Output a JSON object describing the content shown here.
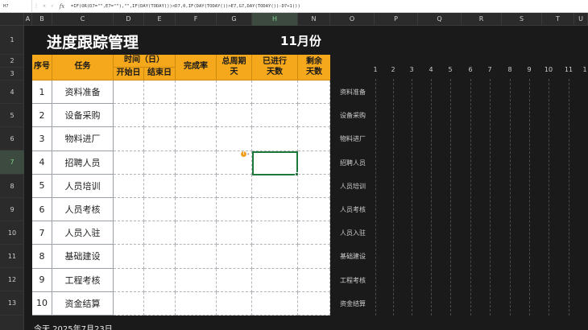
{
  "formula_bar": {
    "name_box": "H7",
    "fx": "fx",
    "formula": "=IF(OR(D7=\"\",E7=\"\"),\"\",IF(DAY(TODAY())<D7,0,IF(DAY(TODAY())>E7,G7,DAY(TODAY())-D7+1)))"
  },
  "columns": [
    "A",
    "B",
    "C",
    "D",
    "E",
    "F",
    "G",
    "H",
    "N",
    "O",
    "P",
    "Q",
    "R",
    "S",
    "T",
    "U"
  ],
  "selected_column": "H",
  "rows": [
    "1",
    "2",
    "3",
    "4",
    "5",
    "6",
    "7",
    "8",
    "9",
    "10",
    "11",
    "12",
    "13"
  ],
  "selected_row": "7",
  "sheet": {
    "title": "进度跟踪管理",
    "month": "11月份"
  },
  "table": {
    "headers": {
      "seq": "序号",
      "task": "任务",
      "time": "时间（日）",
      "start": "开始日",
      "end": "结束日",
      "completion": "完成率",
      "total_days": "总周期\n天",
      "elapsed": "已进行\n天数",
      "remaining": "剩余\n天数"
    },
    "rows": [
      {
        "seq": "1",
        "task": "资料准备"
      },
      {
        "seq": "2",
        "task": "设备采购"
      },
      {
        "seq": "3",
        "task": "物料进厂"
      },
      {
        "seq": "4",
        "task": "招聘人员"
      },
      {
        "seq": "5",
        "task": "人员培训"
      },
      {
        "seq": "6",
        "task": "人员考核"
      },
      {
        "seq": "7",
        "task": "人员入驻"
      },
      {
        "seq": "8",
        "task": "基础建设"
      },
      {
        "seq": "9",
        "task": "工程考核"
      },
      {
        "seq": "10",
        "task": "资金结算"
      }
    ]
  },
  "gantt": {
    "days": [
      "1",
      "2",
      "3",
      "4",
      "5",
      "6",
      "7",
      "8",
      "9",
      "10",
      "11",
      "1"
    ],
    "labels": [
      "资料准备",
      "设备采购",
      "物料进厂",
      "招聘人员",
      "人员培训",
      "人员考核",
      "人员入驻",
      "基础建设",
      "工程考核",
      "资金结算"
    ]
  },
  "today_text": "今天  2025年7月23日",
  "colors": {
    "header_orange": "#f5a81c",
    "selection_green": "#1e7a3c",
    "background": "#1a1a1a"
  }
}
